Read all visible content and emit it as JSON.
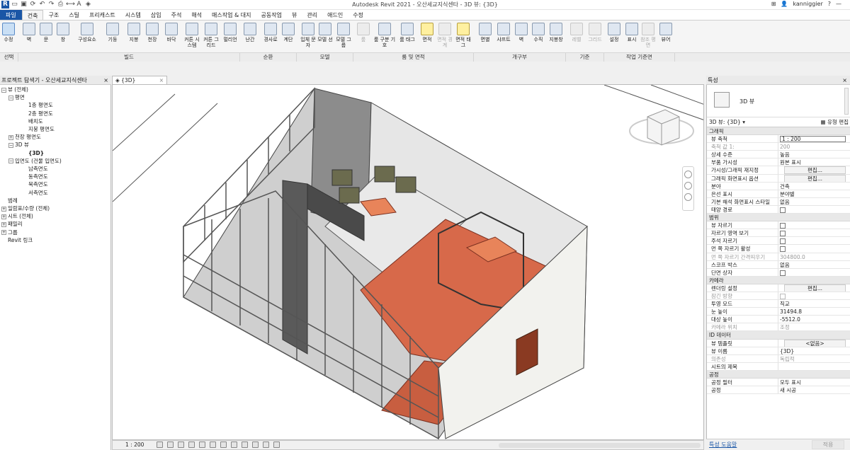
{
  "app": {
    "title": "Autodesk Revit 2021 - 오산세교지식센타 - 3D 뷰: {3D}",
    "username": "kanniggier",
    "help": "?"
  },
  "ribbon": {
    "tabs": [
      "파일",
      "건축",
      "구조",
      "스틸",
      "프리캐스트",
      "시스템",
      "삽입",
      "주석",
      "해석",
      "매스작업 & 대지",
      "공동작업",
      "뷰",
      "관리",
      "애드인",
      "수정"
    ],
    "buttons": [
      {
        "label": "수정",
        "enabled": true
      },
      {
        "label": "벽",
        "enabled": true
      },
      {
        "label": "문",
        "enabled": true
      },
      {
        "label": "창",
        "enabled": true
      },
      {
        "label": "구성요소",
        "enabled": true
      },
      {
        "label": "기둥",
        "enabled": true
      },
      {
        "label": "지붕",
        "enabled": true
      },
      {
        "label": "천장",
        "enabled": true
      },
      {
        "label": "바닥",
        "enabled": true
      },
      {
        "label": "커튼 시스템",
        "enabled": true
      },
      {
        "label": "커튼 그리드",
        "enabled": true
      },
      {
        "label": "멀리언",
        "enabled": true
      },
      {
        "label": "난간",
        "enabled": true
      },
      {
        "label": "경사로",
        "enabled": true
      },
      {
        "label": "계단",
        "enabled": true
      },
      {
        "label": "입체 문자",
        "enabled": true
      },
      {
        "label": "모델 선",
        "enabled": true
      },
      {
        "label": "모델 그룹",
        "enabled": true
      },
      {
        "label": "룸",
        "enabled": false
      },
      {
        "label": "룸 구분 기호",
        "enabled": true
      },
      {
        "label": "룸 태그",
        "enabled": true
      },
      {
        "label": "면적",
        "enabled": true
      },
      {
        "label": "면적 경계",
        "enabled": false
      },
      {
        "label": "면적 태그",
        "enabled": true
      },
      {
        "label": "면별",
        "enabled": true
      },
      {
        "label": "샤프트",
        "enabled": true
      },
      {
        "label": "벽",
        "enabled": true
      },
      {
        "label": "수직",
        "enabled": true
      },
      {
        "label": "지붕창",
        "enabled": true
      },
      {
        "label": "레벨",
        "enabled": false
      },
      {
        "label": "그리드",
        "enabled": false
      },
      {
        "label": "설정",
        "enabled": true
      },
      {
        "label": "표시",
        "enabled": true
      },
      {
        "label": "참조 평면",
        "enabled": false
      },
      {
        "label": "뷰어",
        "enabled": true
      }
    ],
    "groups": [
      "선택",
      "빌드",
      "순환",
      "모델",
      "룸 및 면적",
      "개구부",
      "기준",
      "작업 기준면"
    ]
  },
  "project_browser": {
    "title": "프로젝트 탐색기 - 오산세교지식센타",
    "close": "×",
    "items": [
      {
        "toggle": "−",
        "text": "뷰 (전체)"
      },
      {
        "toggle": "−",
        "text": "평면"
      },
      {
        "toggle": "",
        "text": "1층 평면도"
      },
      {
        "toggle": "",
        "text": "2층 평면도"
      },
      {
        "toggle": "",
        "text": "배치도"
      },
      {
        "toggle": "",
        "text": "지붕 평면도"
      },
      {
        "toggle": "+",
        "text": "천장 평면도"
      },
      {
        "toggle": "−",
        "text": "3D 뷰"
      },
      {
        "toggle": "",
        "text": "{3D}"
      },
      {
        "toggle": "−",
        "text": "입면도 (건물 입면도)"
      },
      {
        "toggle": "",
        "text": "남측면도"
      },
      {
        "toggle": "",
        "text": "동측면도"
      },
      {
        "toggle": "",
        "text": "북측면도"
      },
      {
        "toggle": "",
        "text": "서측면도"
      },
      {
        "toggle": "",
        "text": "범례"
      },
      {
        "toggle": "+",
        "text": "일람표/수량 (전체)"
      },
      {
        "toggle": "+",
        "text": "시트 (전체)"
      },
      {
        "toggle": "+",
        "text": "패밀리"
      },
      {
        "toggle": "+",
        "text": "그룹"
      },
      {
        "toggle": "",
        "text": "Revit 링크"
      }
    ]
  },
  "view": {
    "tab_label": "{3D}",
    "tab_close": "×",
    "scale": "1 : 200"
  },
  "properties": {
    "title": "특성",
    "close": "×",
    "type_name": "3D 뷰",
    "instance_selector": "3D 뷰: {3D}",
    "edit_type": "유형 편집",
    "sections": [
      {
        "name": "그래픽",
        "rows": [
          {
            "label": "뷰 축척",
            "value": "1 : 200",
            "kind": "box"
          },
          {
            "label": "축척 값    1:",
            "value": "200",
            "kind": "text",
            "dim": true
          },
          {
            "label": "상세 수준",
            "value": "높음",
            "kind": "text"
          },
          {
            "label": "부품 가시성",
            "value": "원본 표시",
            "kind": "text"
          },
          {
            "label": "가시성/그래픽 재지정",
            "value": "편집...",
            "kind": "btn"
          },
          {
            "label": "그래픽 화면표시 옵션",
            "value": "편집...",
            "kind": "btn"
          },
          {
            "label": "분야",
            "value": "건축",
            "kind": "text"
          },
          {
            "label": "은선 표시",
            "value": "분야별",
            "kind": "text"
          },
          {
            "label": "기본 해석 화면표시 스타일",
            "value": "없음",
            "kind": "text"
          },
          {
            "label": "태양 경로",
            "value": "",
            "kind": "check"
          }
        ]
      },
      {
        "name": "범위",
        "rows": [
          {
            "label": "뷰 자르기",
            "value": "",
            "kind": "check"
          },
          {
            "label": "자르기 영역 보기",
            "value": "",
            "kind": "check"
          },
          {
            "label": "주석 자르기",
            "value": "",
            "kind": "check"
          },
          {
            "label": "먼 쪽 자르기 활성",
            "value": "",
            "kind": "check"
          },
          {
            "label": "먼 쪽 자르기 간격띄우기",
            "value": "304800.0",
            "kind": "text",
            "dim": true
          },
          {
            "label": "스코프 박스",
            "value": "없음",
            "kind": "text"
          },
          {
            "label": "단면 상자",
            "value": "",
            "kind": "check"
          }
        ]
      },
      {
        "name": "카메라",
        "rows": [
          {
            "label": "렌더링 설정",
            "value": "편집...",
            "kind": "btn"
          },
          {
            "label": "잠긴 방향",
            "value": "",
            "kind": "check",
            "dim": true
          },
          {
            "label": "투영 모드",
            "value": "직교",
            "kind": "text"
          },
          {
            "label": "눈 높이",
            "value": "31494.8",
            "kind": "text"
          },
          {
            "label": "대상 높이",
            "value": "-5512.0",
            "kind": "text"
          },
          {
            "label": "카메라 위치",
            "value": "조정",
            "kind": "text",
            "dim": true
          }
        ]
      },
      {
        "name": "ID 데이터",
        "rows": [
          {
            "label": "뷰 템플릿",
            "value": "<없음>",
            "kind": "btn"
          },
          {
            "label": "뷰 이름",
            "value": "{3D}",
            "kind": "text"
          },
          {
            "label": "의존성",
            "value": "독립적",
            "kind": "text",
            "dim": true
          },
          {
            "label": "시트의 제목",
            "value": "",
            "kind": "text"
          }
        ]
      },
      {
        "name": "공정",
        "rows": [
          {
            "label": "공정 필터",
            "value": "모두 표시",
            "kind": "text"
          },
          {
            "label": "공정",
            "value": "새 시공",
            "kind": "text"
          }
        ]
      }
    ],
    "help_link": "특성 도움말",
    "apply": "적용"
  },
  "colors": {
    "accent": "#1a56a6",
    "floor": "#d7694a",
    "wall": "#808080",
    "glazing": "#e8b8a8"
  }
}
